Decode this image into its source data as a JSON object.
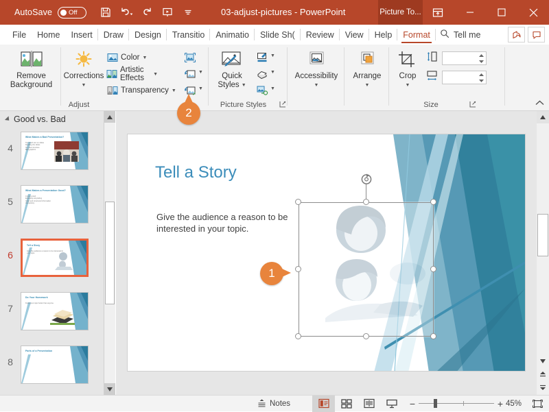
{
  "titlebar": {
    "autosave_label": "AutoSave",
    "autosave_state": "Off",
    "document_title": "03-adjust-pictures  -  PowerPoint",
    "context_tab": "Picture To...",
    "quick_access": [
      "save-icon",
      "undo-icon",
      "redo-icon",
      "start-presentation-icon",
      "customize-qat-icon"
    ],
    "window_controls": [
      "minimize",
      "maximize",
      "close"
    ],
    "accent_color": "#b7472a",
    "context_tab_color": "#9e3a20"
  },
  "menubar": {
    "items": [
      {
        "label": "File",
        "active": false
      },
      {
        "label": "Home",
        "active": false
      },
      {
        "label": "Insert",
        "active": false
      },
      {
        "label": "Draw",
        "active": false
      },
      {
        "label": "Design",
        "active": false
      },
      {
        "label": "Transitio",
        "active": false
      },
      {
        "label": "Animatio",
        "active": false
      },
      {
        "label": "Slide Sh(",
        "active": false
      },
      {
        "label": "Review",
        "active": false
      },
      {
        "label": "View",
        "active": false
      },
      {
        "label": "Help",
        "active": false
      },
      {
        "label": "Format",
        "active": true
      }
    ],
    "tell_me": "Tell me",
    "share_button": "share-icon",
    "comments_button": "comments-icon"
  },
  "ribbon": {
    "groups": [
      {
        "name": "Adjust",
        "label": "Adjust",
        "big_buttons": [
          {
            "label_line1": "Remove",
            "label_line2": "Background",
            "icon": "remove-background-icon"
          },
          {
            "label_line1": "Corrections",
            "label_line2": "",
            "icon": "corrections-icon",
            "has_dropdown": true
          }
        ],
        "small_buttons": [
          {
            "label": "Color",
            "icon": "color-icon",
            "has_dropdown": true
          },
          {
            "label": "Artistic Effects",
            "icon": "artistic-effects-icon",
            "has_dropdown": true
          },
          {
            "label": "Transparency",
            "icon": "transparency-icon",
            "has_dropdown": true
          }
        ],
        "icon_buttons": [
          {
            "icon": "compress-pictures-icon",
            "has_dropdown": false
          },
          {
            "icon": "change-picture-icon",
            "has_dropdown": true
          },
          {
            "icon": "reset-picture-icon",
            "has_dropdown": true
          }
        ]
      },
      {
        "name": "Picture Styles",
        "label": "Picture Styles",
        "big_buttons": [
          {
            "label_line1": "Quick",
            "label_line2": "Styles",
            "icon": "quick-styles-icon",
            "has_dropdown": true
          }
        ],
        "icon_buttons": [
          {
            "icon": "picture-border-icon",
            "has_dropdown": true
          },
          {
            "icon": "picture-effects-icon",
            "has_dropdown": true
          },
          {
            "icon": "picture-layout-icon",
            "has_dropdown": true
          }
        ],
        "has_dialog_launcher": true
      },
      {
        "name": "Accessibility",
        "label": "",
        "big_buttons": [
          {
            "label_line1": "Accessibility",
            "label_line2": "",
            "icon": "accessibility-icon",
            "has_dropdown": true
          }
        ]
      },
      {
        "name": "Arrange",
        "label": "",
        "big_buttons": [
          {
            "label_line1": "Arrange",
            "label_line2": "",
            "icon": "arrange-icon",
            "has_dropdown": true
          }
        ]
      },
      {
        "name": "Size",
        "label": "Size",
        "big_buttons": [
          {
            "label_line1": "Crop",
            "label_line2": "",
            "icon": "crop-icon",
            "has_dropdown": true
          }
        ],
        "fields": [
          {
            "icon": "shape-height-icon",
            "value": "",
            "name": "shape-height"
          },
          {
            "icon": "shape-width-icon",
            "value": "",
            "name": "shape-width"
          }
        ],
        "has_dialog_launcher": true
      }
    ],
    "collapse_icon": "chevron-up-icon"
  },
  "thumbnail_pane": {
    "section_title": "Good vs. Bad",
    "slides": [
      {
        "number": "4",
        "title": "What Makes a Bad Presentation?",
        "body": "Too much text on slides\nReading the slides\nNo clear structure\nBad graphics",
        "selected": false,
        "image": "photo-audience"
      },
      {
        "number": "5",
        "title": "What Makes a Presentation Good?",
        "body": "A strong start\nEngaging storytelling\nClear and structured information\nInteractivity",
        "selected": false,
        "image": "none"
      },
      {
        "number": "6",
        "title": "Tell a Story",
        "body": "Give the audience a reason to be interested in your topic.",
        "selected": true,
        "image": "photo-mother-child"
      },
      {
        "number": "7",
        "title": "Do Your Homework",
        "body": "Know your topic better than anyone.",
        "selected": false,
        "image": "photo-books"
      },
      {
        "number": "8",
        "title": "Parts of a Presentation",
        "body": "",
        "selected": false,
        "image": "none"
      }
    ]
  },
  "slide": {
    "title": "Tell a Story",
    "body": "Give the audience a reason to be interested in your topic.",
    "title_color": "#3c8dba",
    "selected_object": {
      "name": "picture-mother-and-child",
      "handles": [
        "top-left",
        "top-center",
        "top-right",
        "middle-left",
        "middle-right",
        "bottom-left",
        "bottom-center",
        "bottom-right"
      ],
      "rotate_handle": true
    }
  },
  "callouts": [
    {
      "number": "1",
      "points_to": "middle-left-handle"
    },
    {
      "number": "2",
      "points_to": "transparency-button"
    }
  ],
  "statusbar": {
    "notes_label": "Notes",
    "views": [
      {
        "name": "normal-view",
        "icon": "normal-view-icon",
        "active": true
      },
      {
        "name": "slide-sorter-view",
        "icon": "slide-sorter-icon",
        "active": false
      },
      {
        "name": "reading-view",
        "icon": "reading-view-icon",
        "active": false
      },
      {
        "name": "slide-show-view",
        "icon": "slide-show-icon",
        "active": false
      }
    ],
    "zoom_out": "−",
    "zoom_in": "+",
    "zoom_level": "45%",
    "fit_slide": "fit-to-window-icon"
  }
}
